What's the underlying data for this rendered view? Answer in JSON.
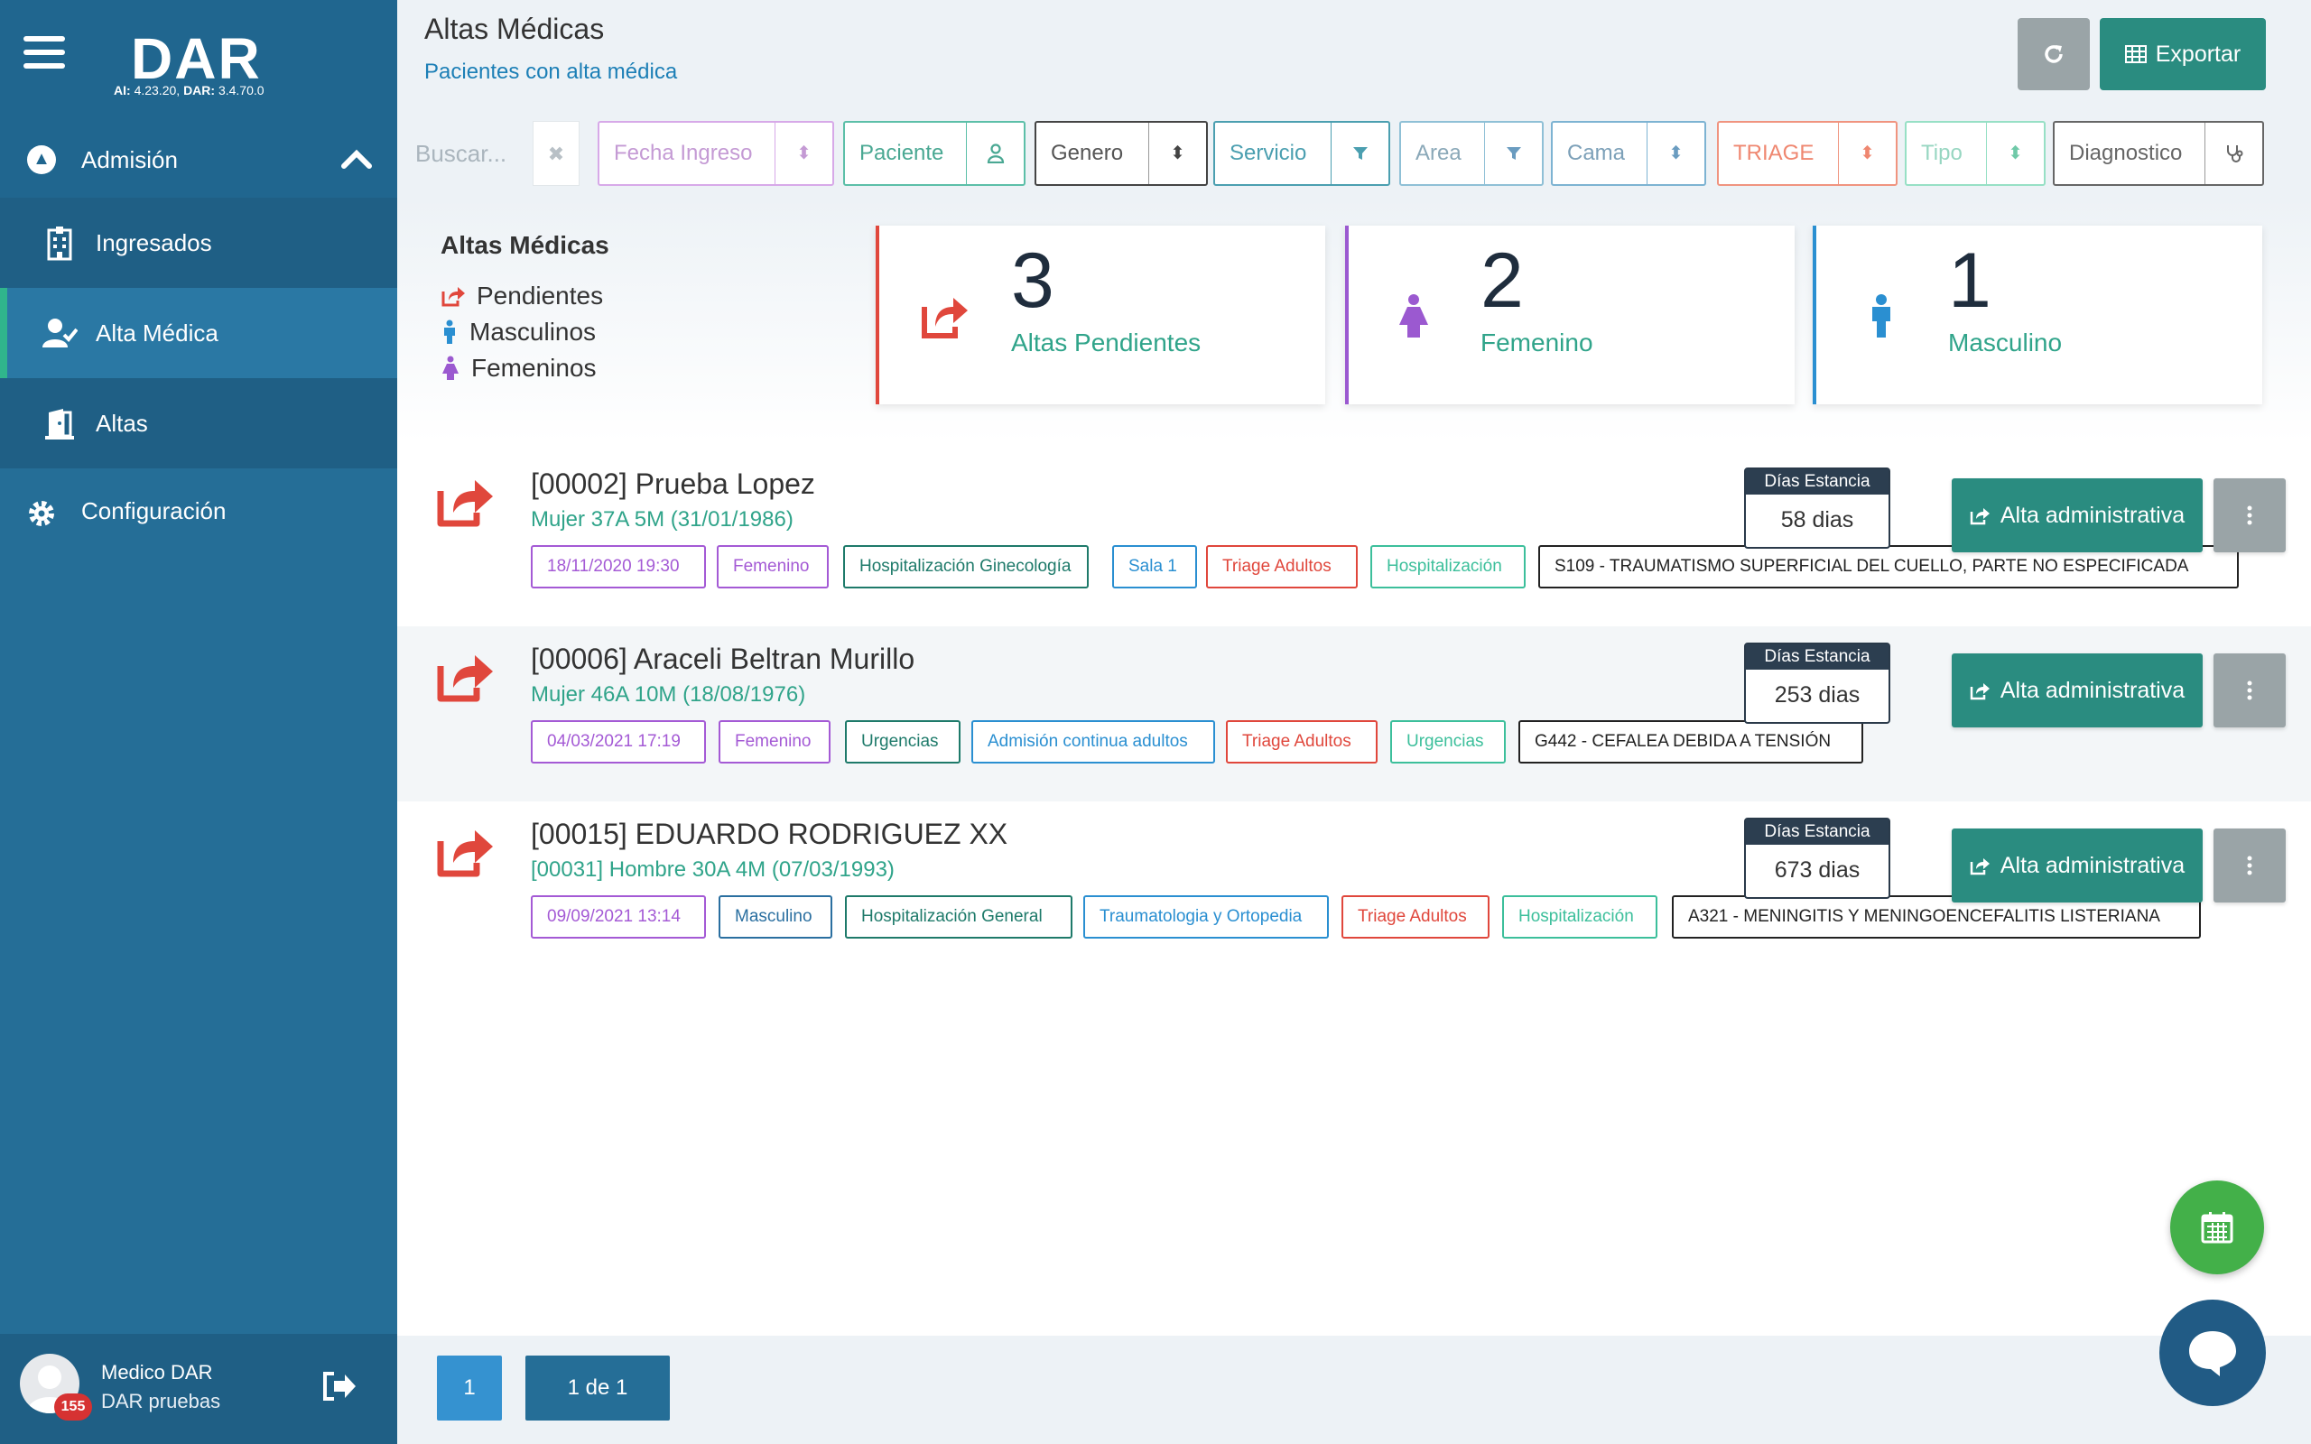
{
  "app": {
    "logo": "DAR",
    "version_ai_label": "AI:",
    "version_ai": "4.23.20,",
    "version_dar_label": "DAR:",
    "version_dar": "3.4.70.0"
  },
  "sidebar": {
    "section": "Admisión",
    "items": [
      {
        "label": "Ingresados",
        "icon": "hospital-icon"
      },
      {
        "label": "Alta Médica",
        "icon": "user-check-icon"
      },
      {
        "label": "Altas",
        "icon": "door-exit-icon"
      }
    ],
    "config_label": "Configuración",
    "user_name": "Medico DAR",
    "user_role": "DAR pruebas",
    "badge": "155"
  },
  "header": {
    "title": "Altas Médicas",
    "subtitle": "Pacientes con alta médica",
    "export_label": "Exportar"
  },
  "filters": {
    "search_placeholder": "Buscar...",
    "items": [
      {
        "label": "Fecha Ingreso",
        "color": "#d7a9e8",
        "text_color": "#c49ad4"
      },
      {
        "label": "Paciente",
        "color": "#5cbfa8",
        "text_color": "#4aa893"
      },
      {
        "label": "Genero",
        "color": "#444",
        "text_color": "#555"
      },
      {
        "label": "Servicio",
        "color": "#4b9fb0",
        "text_color": "#4b9fb0"
      },
      {
        "label": "Area",
        "color": "#8fc0d6",
        "text_color": "#8aa8b8"
      },
      {
        "label": "Cama",
        "color": "#7db3d2",
        "text_color": "#7ca0b8"
      },
      {
        "label": "TRIAGE",
        "color": "#f0947f",
        "text_color": "#ef8770"
      },
      {
        "label": "Tipo",
        "color": "#97e0c5",
        "text_color": "#97d6c1"
      },
      {
        "label": "Diagnostico",
        "color": "#666",
        "text_color": "#666"
      }
    ]
  },
  "summary": {
    "legend_title": "Altas Médicas",
    "legend": [
      "Pendientes",
      "Masculinos",
      "Femeninos"
    ],
    "cards": [
      {
        "value": "3",
        "label": "Altas Pendientes",
        "color": "#e0473c"
      },
      {
        "value": "2",
        "label": "Femenino",
        "color": "#9b59d0"
      },
      {
        "value": "1",
        "label": "Masculino",
        "color": "#2a8fd1"
      }
    ]
  },
  "stay_header": "Días Estancia",
  "alta_label": "Alta administrativa",
  "patients": [
    {
      "name": "[00002] Prueba Lopez",
      "info": "Mujer 37A 5M (31/01/1986)",
      "stay": "58 dias",
      "tags": [
        {
          "text": "18/11/2020 19:30",
          "color": "#a45ad5"
        },
        {
          "text": "Femenino",
          "color": "#a45ad5"
        },
        {
          "text": "Hospitalización Ginecología",
          "color": "#1e7a6a"
        },
        {
          "text": "Sala 1",
          "color": "#2a8fd1"
        },
        {
          "text": "Triage Adultos",
          "color": "#e0473c"
        },
        {
          "text": "Hospitalización",
          "color": "#3cbf9b"
        },
        {
          "text": "S109 - TRAUMATISMO SUPERFICIAL DEL CUELLO, PARTE NO ESPECIFICADA",
          "color": "#222"
        }
      ]
    },
    {
      "name": "[00006] Araceli Beltran Murillo",
      "info": "Mujer 46A 10M (18/08/1976)",
      "stay": "253 dias",
      "tags": [
        {
          "text": "04/03/2021 17:19",
          "color": "#a45ad5"
        },
        {
          "text": "Femenino",
          "color": "#a45ad5"
        },
        {
          "text": "Urgencias",
          "color": "#1e7a6a"
        },
        {
          "text": "Admisión continua adultos",
          "color": "#2a8fd1"
        },
        {
          "text": "Triage Adultos",
          "color": "#e0473c"
        },
        {
          "text": "Urgencias",
          "color": "#3cbf9b"
        },
        {
          "text": "G442 - CEFALEA DEBIDA A TENSIÓN",
          "color": "#222"
        }
      ]
    },
    {
      "name": "[00015] EDUARDO RODRIGUEZ XX",
      "info": "[00031] Hombre 30A 4M (07/03/1993)",
      "stay": "673 dias",
      "tags": [
        {
          "text": "09/09/2021 13:14",
          "color": "#a45ad5"
        },
        {
          "text": "Masculino",
          "color": "#2a6fa0"
        },
        {
          "text": "Hospitalización General",
          "color": "#1e7a6a"
        },
        {
          "text": "Traumatologia y Ortopedia",
          "color": "#2a8fd1"
        },
        {
          "text": "Triage Adultos",
          "color": "#e0473c"
        },
        {
          "text": "Hospitalización",
          "color": "#3cbf9b"
        },
        {
          "text": "A321 - MENINGITIS Y MENINGOENCEFALITIS LISTERIANA",
          "color": "#222"
        }
      ]
    }
  ],
  "pager": {
    "page": "1",
    "info": "1 de 1"
  }
}
